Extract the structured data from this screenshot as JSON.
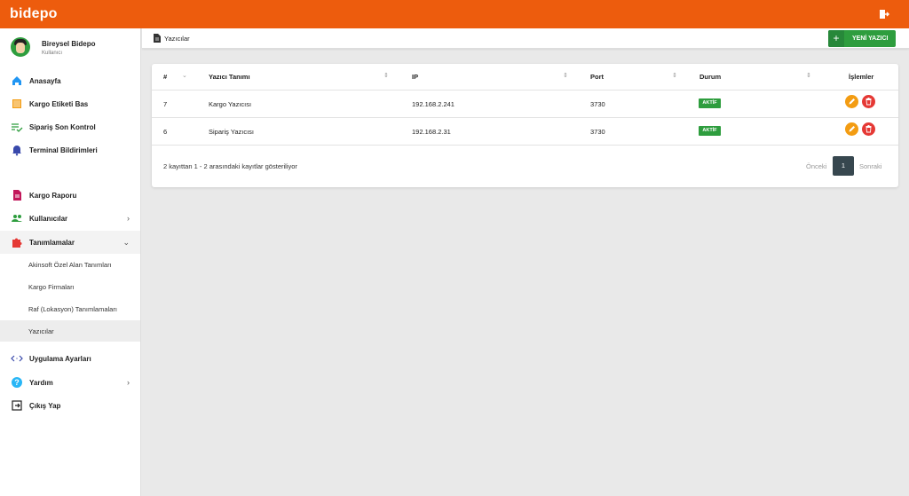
{
  "app": {
    "brand": "bidepo"
  },
  "profile": {
    "name": "Bireysel Bidepo",
    "role": "Kullanıcı"
  },
  "sidebar": {
    "items": [
      {
        "label": "Anasayfa",
        "icon": "home-icon"
      },
      {
        "label": "Kargo Etiketi Bas",
        "icon": "barcode-icon"
      },
      {
        "label": "Sipariş Son Kontrol",
        "icon": "checklist-icon"
      },
      {
        "label": "Terminal Bildirimleri",
        "icon": "bell-icon"
      },
      {
        "label": "Kargo Raporu",
        "icon": "report-icon"
      },
      {
        "label": "Kullanıcılar",
        "icon": "users-icon"
      },
      {
        "label": "Tanımlamalar",
        "icon": "puzzle-icon"
      },
      {
        "label": "Uygulama Ayarları",
        "icon": "code-icon"
      },
      {
        "label": "Yardım",
        "icon": "help-icon"
      },
      {
        "label": "Çıkış Yap",
        "icon": "exit-icon"
      }
    ],
    "subitems": [
      {
        "label": "Akinsoft Özel Alan Tanımları"
      },
      {
        "label": "Kargo Firmaları"
      },
      {
        "label": "Raf (Lokasyon) Tanımlamaları"
      },
      {
        "label": "Yazıcılar"
      }
    ]
  },
  "header": {
    "title": "Yazıcılar",
    "new_button": "YENİ YAZICI"
  },
  "table": {
    "columns": [
      "#",
      "Yazıcı Tanımı",
      "IP",
      "Port",
      "Durum",
      "İşlemler"
    ],
    "rows": [
      {
        "id": "7",
        "name": "Kargo Yazıcısı",
        "ip": "192.168.2.241",
        "port": "3730",
        "status": "AKTİF"
      },
      {
        "id": "6",
        "name": "Sipariş Yazıcısı",
        "ip": "192.168.2.31",
        "port": "3730",
        "status": "AKTİF"
      }
    ]
  },
  "footer": {
    "summary": "2 kayıttan 1 - 2 arasındaki kayıtlar gösteriliyor"
  },
  "pagination": {
    "prev": "Önceki",
    "current": "1",
    "next": "Sonraki"
  },
  "colors": {
    "topbar": "#ed5c0d",
    "accent_green": "#2e9d3e",
    "edit": "#f39c12",
    "delete": "#e53935",
    "page_active": "#37474f"
  }
}
